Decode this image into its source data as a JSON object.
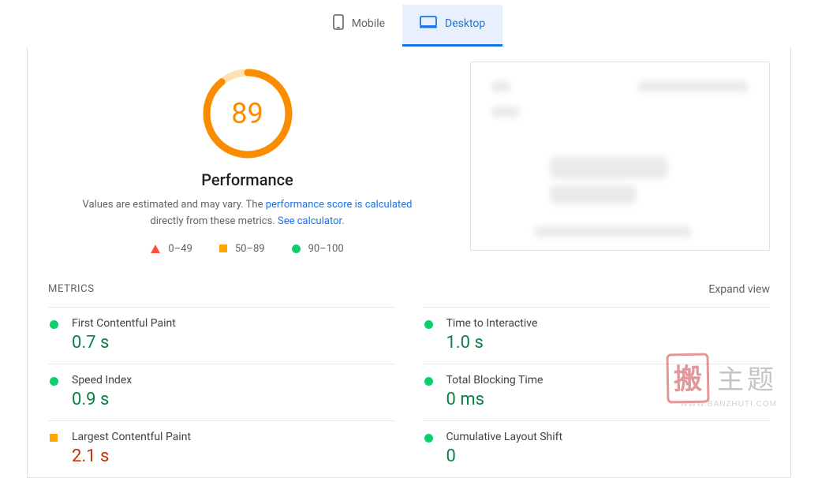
{
  "tabs": {
    "mobile": "Mobile",
    "desktop": "Desktop",
    "active": "desktop"
  },
  "score": {
    "value": "89",
    "pct": 89,
    "color": "#fb8c00",
    "track": "#ffe0b2"
  },
  "heading": "Performance",
  "desc": {
    "pre": "Values are estimated and may vary. The ",
    "link1": "performance score is calculated",
    "mid": " directly from these metrics. ",
    "link2": "See calculator"
  },
  "legend": {
    "bad": "0–49",
    "avg": "50–89",
    "good": "90–100"
  },
  "metrics_header": "METRICS",
  "expand": "Expand view",
  "metrics": [
    {
      "name": "First Contentful Paint",
      "value": "0.7 s",
      "status": "good"
    },
    {
      "name": "Time to Interactive",
      "value": "1.0 s",
      "status": "good"
    },
    {
      "name": "Speed Index",
      "value": "0.9 s",
      "status": "good"
    },
    {
      "name": "Total Blocking Time",
      "value": "0 ms",
      "status": "good"
    },
    {
      "name": "Largest Contentful Paint",
      "value": "2.1 s",
      "status": "avg"
    },
    {
      "name": "Cumulative Layout Shift",
      "value": "0",
      "status": "good"
    }
  ],
  "watermark": {
    "stamp": "搬",
    "cjk": "主题",
    "url": "WWW.BANZHUTI.COM"
  }
}
